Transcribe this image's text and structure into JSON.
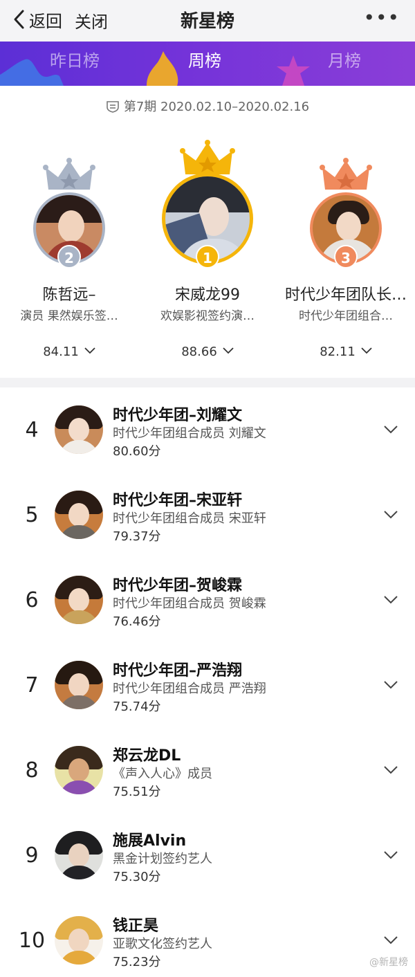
{
  "nav": {
    "back_label": "返回",
    "close_label": "关闭",
    "title": "新星榜",
    "more_label": "•••"
  },
  "tabs": [
    {
      "label": "昨日榜",
      "active": false
    },
    {
      "label": "周榜",
      "active": true
    },
    {
      "label": "月榜",
      "active": false
    }
  ],
  "period": "第7期  2020.02.10–2020.02.16",
  "podium": [
    {
      "rank": "1",
      "name": "宋威龙99",
      "desc": "欢娱影视签约演…",
      "score": "88.66",
      "crown": "gold"
    },
    {
      "rank": "2",
      "name": "陈哲远–",
      "desc": "演员 果然娱乐签…",
      "score": "84.11",
      "crown": "silver"
    },
    {
      "rank": "3",
      "name": "时代少年团队长…",
      "desc": "时代少年团组合…",
      "score": "82.11",
      "crown": "bronze"
    }
  ],
  "list": [
    {
      "rank": "4",
      "name": "时代少年团–刘耀文",
      "desc": "时代少年团组合成员 刘耀文",
      "score": "80.60分"
    },
    {
      "rank": "5",
      "name": "时代少年团–宋亚轩",
      "desc": "时代少年团组合成员 宋亚轩",
      "score": "79.37分"
    },
    {
      "rank": "6",
      "name": "时代少年团–贺峻霖",
      "desc": "时代少年团组合成员 贺峻霖",
      "score": "76.46分"
    },
    {
      "rank": "7",
      "name": "时代少年团–严浩翔",
      "desc": "时代少年团组合成员 严浩翔",
      "score": "75.74分"
    },
    {
      "rank": "8",
      "name": "郑云龙DL",
      "desc": "《声入人心》成员",
      "score": "75.51分"
    },
    {
      "rank": "9",
      "name": "施展Alvin",
      "desc": "黑金计划签约艺人",
      "score": "75.30分"
    },
    {
      "rank": "10",
      "name": "钱正昊",
      "desc": "亚歌文化签约艺人",
      "score": "75.23分"
    }
  ],
  "watermark": "@新星榜",
  "colors": {
    "tab_bar": "#6a30d8",
    "gold": "#f5b50a",
    "silver": "#a9b4c6",
    "bronze": "#f08a5d"
  },
  "icons": {
    "back": "chevron-left-icon",
    "more": "more-dots-icon",
    "period": "calendar-list-icon",
    "expand": "chevron-down-icon",
    "crown": "crown-icon"
  }
}
